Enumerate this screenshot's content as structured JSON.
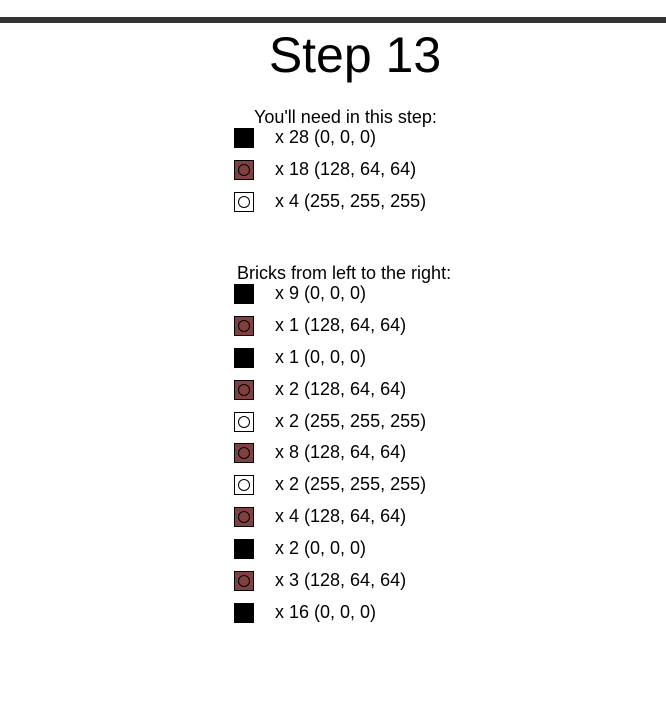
{
  "page": {
    "title": "Step 13"
  },
  "colors": {
    "0, 0, 0": "#000000",
    "128, 64, 64": "#804040",
    "255, 255, 255": "#ffffff"
  },
  "needed": {
    "heading": "You'll need in this step:",
    "items": [
      {
        "label": "x 28 (0, 0, 0)",
        "rgb": "0, 0, 0"
      },
      {
        "label": "x 18 (128, 64, 64)",
        "rgb": "128, 64, 64"
      },
      {
        "label": "x 4 (255, 255, 255)",
        "rgb": "255, 255, 255"
      }
    ]
  },
  "bricks": {
    "heading": "Bricks from left to the right:",
    "items": [
      {
        "label": "x 9 (0, 0, 0)",
        "rgb": "0, 0, 0"
      },
      {
        "label": "x 1 (128, 64, 64)",
        "rgb": "128, 64, 64"
      },
      {
        "label": "x 1 (0, 0, 0)",
        "rgb": "0, 0, 0"
      },
      {
        "label": "x 2 (128, 64, 64)",
        "rgb": "128, 64, 64"
      },
      {
        "label": "x 2 (255, 255, 255)",
        "rgb": "255, 255, 255"
      },
      {
        "label": "x 8 (128, 64, 64)",
        "rgb": "128, 64, 64"
      },
      {
        "label": "x 2 (255, 255, 255)",
        "rgb": "255, 255, 255"
      },
      {
        "label": "x 4 (128, 64, 64)",
        "rgb": "128, 64, 64"
      },
      {
        "label": "x 2 (0, 0, 0)",
        "rgb": "0, 0, 0"
      },
      {
        "label": "x 3 (128, 64, 64)",
        "rgb": "128, 64, 64"
      },
      {
        "label": "x 16 (0, 0, 0)",
        "rgb": "0, 0, 0"
      }
    ]
  }
}
